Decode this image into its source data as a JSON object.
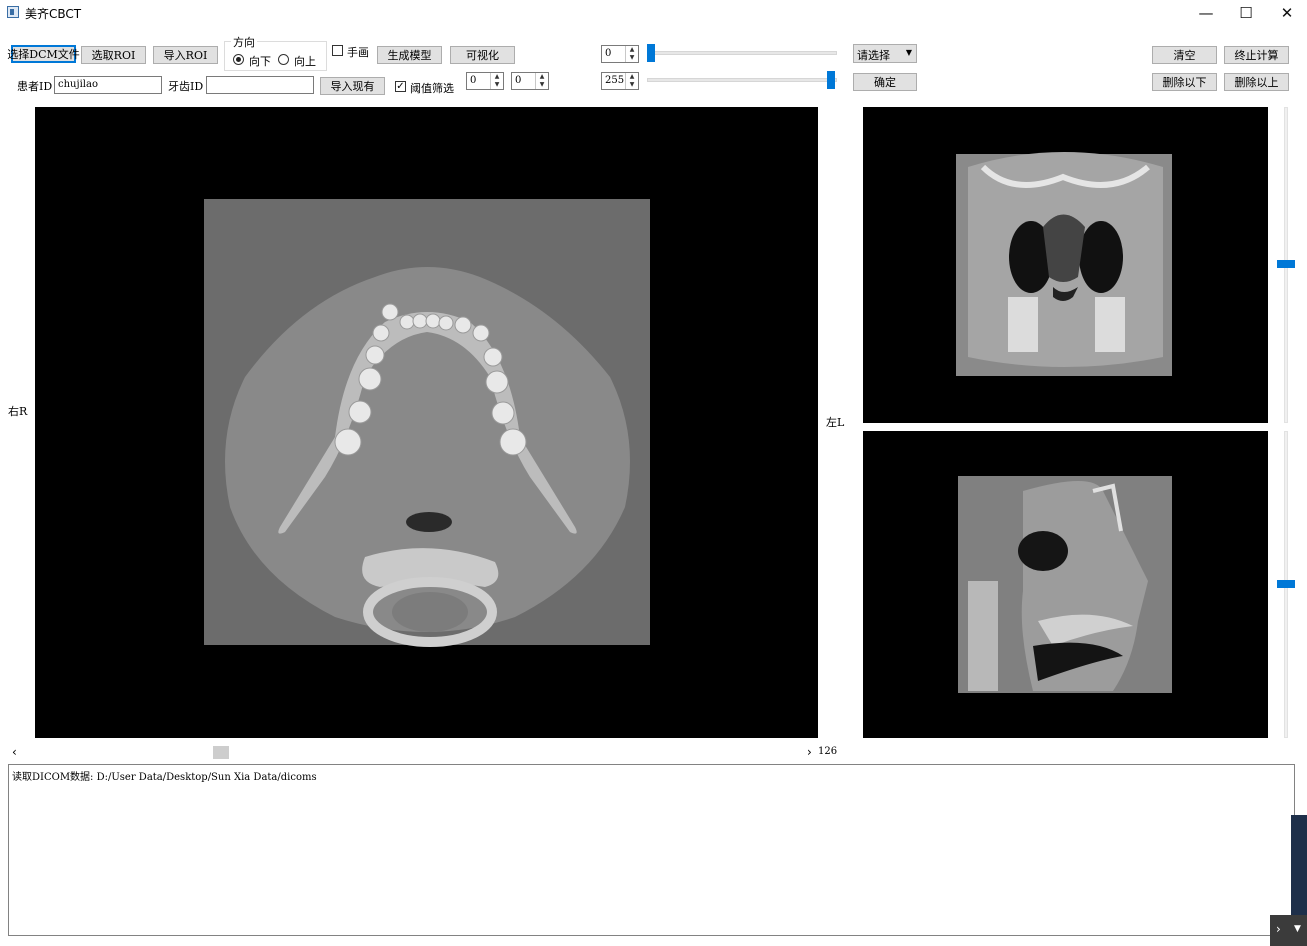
{
  "window": {
    "title": "美齐CBCT",
    "minimize_glyph": "—",
    "maximize_glyph": "☐",
    "close_glyph": "✕"
  },
  "toolbar": {
    "select_dcm": "选择DCM文件",
    "select_roi": "选取ROI",
    "import_roi": "导入ROI",
    "direction_label": "方向",
    "dir_down": "向下",
    "dir_up": "向上",
    "hand_draw": "手画",
    "gen_model": "生成模型",
    "visualize": "可视化",
    "patient_id_label": "患者ID",
    "patient_id_value": "chujilao",
    "tooth_id_label": "牙齿ID",
    "tooth_id_value": "",
    "import_existing": "导入现有",
    "threshold_filter": "阈值筛选",
    "threshold_min": "0",
    "threshold_max": "0",
    "level_low": "0",
    "level_high": "255",
    "dropdown_value": "请选择",
    "confirm": "确定",
    "clear": "清空",
    "stop_calc": "终止计算",
    "delete_below": "删除以下",
    "delete_above": "删除以上"
  },
  "sliders": {
    "low_fraction": 0.0,
    "high_fraction": 1.0
  },
  "views": {
    "label_right": "右R",
    "label_left": "左L",
    "slice_index": "126"
  },
  "log": {
    "line": "读取DICOM数据: D:/User Data/Desktop/Sun Xia Data/dicoms"
  },
  "colors": {
    "accent": "#0078d7",
    "view_bg": "#000000"
  }
}
